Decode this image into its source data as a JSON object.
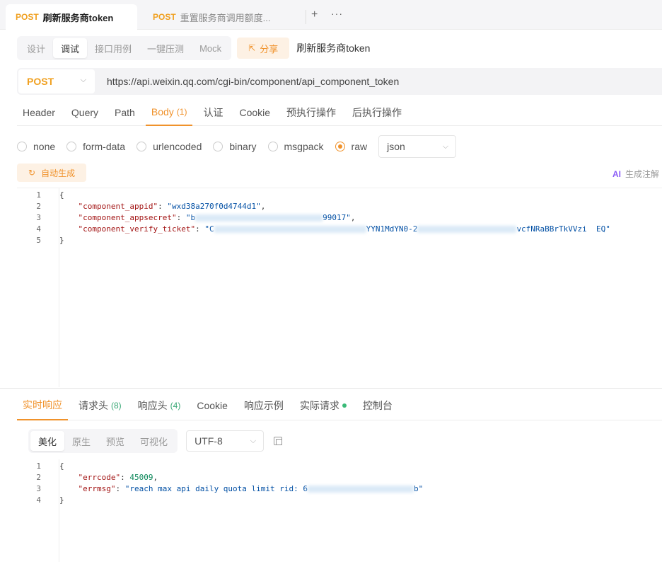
{
  "tabs": [
    {
      "method": "POST",
      "title": "刷新服务商token"
    },
    {
      "method": "POST",
      "title": "重置服务商调用额度..."
    }
  ],
  "tab_actions": {
    "plus": "+",
    "more": "···"
  },
  "modes": [
    "设计",
    "调试",
    "接口用例",
    "一键压测",
    "Mock"
  ],
  "active_mode": "调试",
  "share_label": "分享",
  "api_name": "刷新服务商token",
  "request": {
    "method": "POST",
    "url": "https://api.weixin.qq.com/cgi-bin/component/api_component_token"
  },
  "param_tabs": [
    {
      "label": "Header",
      "count": ""
    },
    {
      "label": "Query",
      "count": ""
    },
    {
      "label": "Path",
      "count": ""
    },
    {
      "label": "Body",
      "count": "(1)"
    },
    {
      "label": "认证",
      "count": ""
    },
    {
      "label": "Cookie",
      "count": ""
    },
    {
      "label": "预执行操作",
      "count": ""
    },
    {
      "label": "后执行操作",
      "count": ""
    }
  ],
  "body_types": [
    "none",
    "form-data",
    "urlencoded",
    "binary",
    "msgpack",
    "raw"
  ],
  "selected_body_type": "raw",
  "raw_format": "json",
  "autogen_label": "自动生成",
  "ai_note": {
    "badge": "AI",
    "text": "生成注解"
  },
  "request_body": {
    "open": "{",
    "close": "}",
    "appid_key": "\"component_appid\"",
    "appid_val": "\"wxd38a270f0d4744d1\"",
    "secret_key": "\"component_appsecret\"",
    "secret_val_start": "\"b",
    "secret_val_end": "99017\"",
    "ticket_key": "\"component_verify_ticket\"",
    "ticket_val_start": "\"C",
    "ticket_val_mid": "YYN1MdYN0-2",
    "ticket_val_end": "vcfNRaBBrTkVVzi  EQ\""
  },
  "response_tabs": [
    {
      "label": "实时响应",
      "count": "",
      "dot": false
    },
    {
      "label": "请求头",
      "count": "(8)",
      "dot": false
    },
    {
      "label": "响应头",
      "count": "(4)",
      "dot": false
    },
    {
      "label": "Cookie",
      "count": "",
      "dot": false
    },
    {
      "label": "响应示例",
      "count": "",
      "dot": false
    },
    {
      "label": "实际请求",
      "count": "",
      "dot": true
    },
    {
      "label": "控制台",
      "count": "",
      "dot": false
    }
  ],
  "view_modes": [
    "美化",
    "原生",
    "预览",
    "可视化"
  ],
  "active_view": "美化",
  "encoding": "UTF-8",
  "response_body": {
    "open": "{",
    "close": "}",
    "errcode_key": "\"errcode\"",
    "errcode_val": "45009",
    "errmsg_key": "\"errmsg\"",
    "errmsg_val_start": "\"reach max api daily quota limit rid: 6",
    "errmsg_val_end": "b\""
  },
  "colors": {
    "accent": "#f0922b",
    "method": "#f0a020",
    "ok_dot": "#3aba78"
  }
}
